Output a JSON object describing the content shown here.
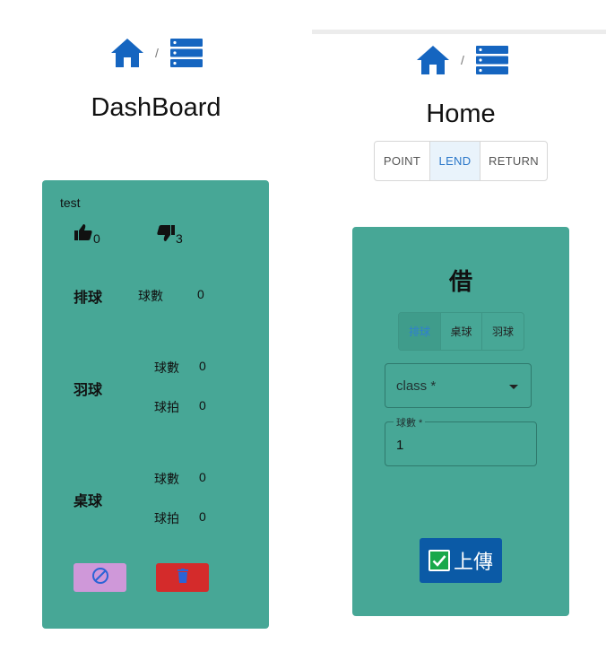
{
  "dashboard": {
    "title": "DashBoard",
    "breadcrumb_separator": "/",
    "card": {
      "name": "test",
      "likes": "0",
      "dislikes": "3",
      "volleyball": {
        "label": "排球",
        "balls_label": "球數",
        "balls_value": "0"
      },
      "badminton": {
        "label": "羽球",
        "balls_label": "球數",
        "balls_value": "0",
        "rackets_label": "球拍",
        "rackets_value": "0"
      },
      "tabletennis": {
        "label": "桌球",
        "balls_label": "球數",
        "balls_value": "0",
        "rackets_label": "球拍",
        "rackets_value": "0"
      }
    }
  },
  "home": {
    "title": "Home",
    "breadcrumb_separator": "/",
    "tabs": [
      {
        "label": "POINT"
      },
      {
        "label": "LEND"
      },
      {
        "label": "RETURN"
      }
    ],
    "active_tab": "LEND",
    "form": {
      "heading": "借",
      "sports": [
        {
          "label": "排球"
        },
        {
          "label": "桌球"
        },
        {
          "label": "羽球"
        }
      ],
      "active_sport": "排球",
      "class_placeholder": "class *",
      "count_label": "球數 *",
      "count_value": "1",
      "submit_label": "上傳"
    }
  },
  "icons": {
    "home": "home-icon",
    "list": "list-icon",
    "thumb_up": "thumb-up-icon",
    "thumb_down": "thumb-down-icon",
    "ban": "ban-icon",
    "delete": "trash-icon",
    "check": "checkbox-icon"
  },
  "colors": {
    "card": "#47a796",
    "primary_blue": "#1565c0",
    "ban_button": "#cf98d9",
    "delete_button": "#d42b2b",
    "submit_button": "#0b5aa6"
  }
}
